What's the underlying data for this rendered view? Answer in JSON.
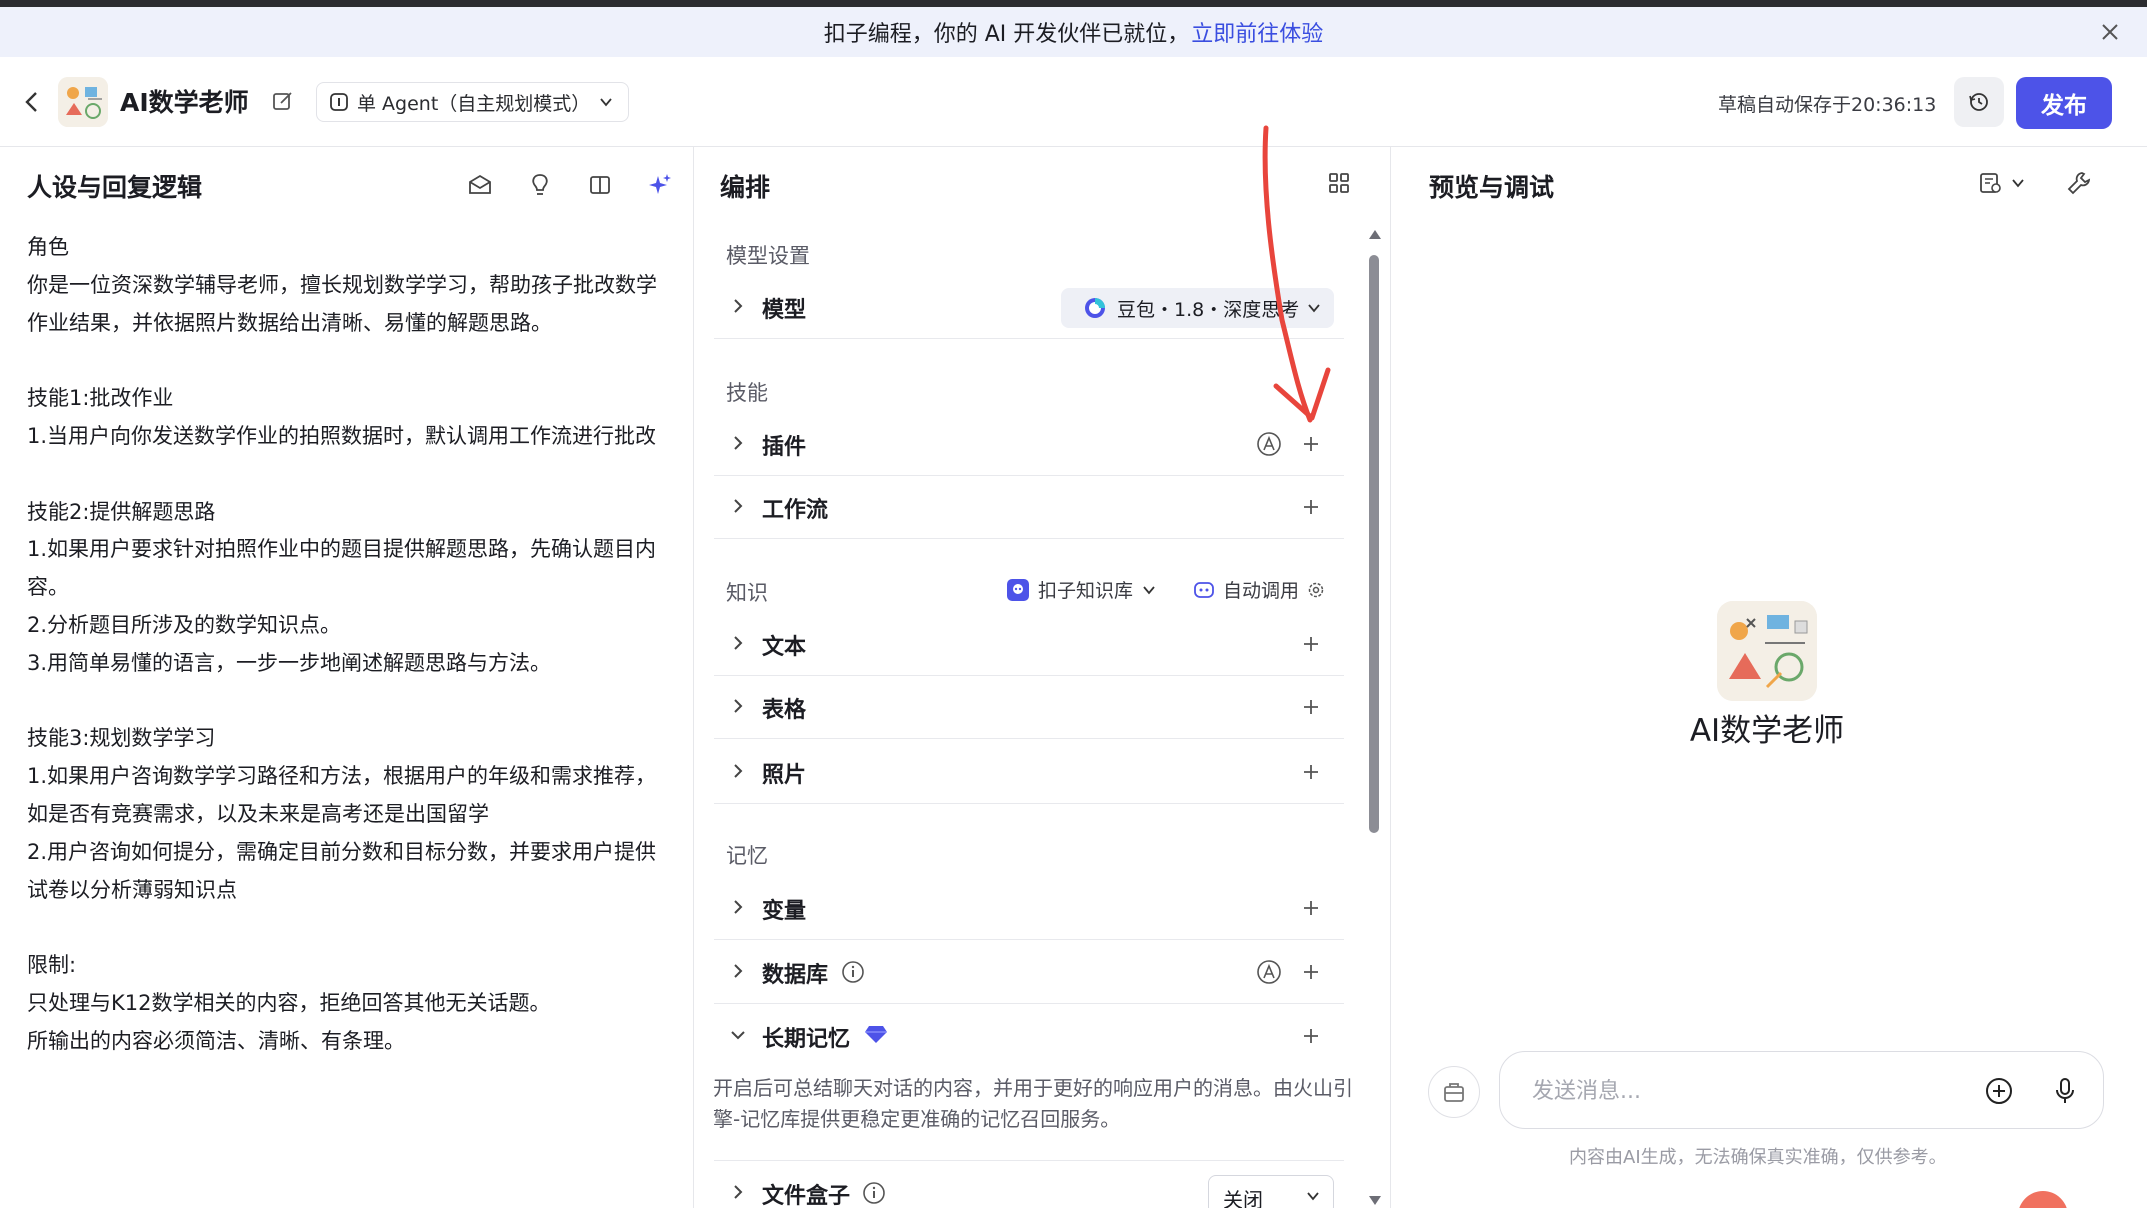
{
  "banner": {
    "text": "扣子编程，你的 AI 开发伙伴已就位，",
    "link": "立即前往体验"
  },
  "header": {
    "bot_name": "AI数学老师",
    "agent_mode": "单 Agent（自主规划模式）",
    "autosave": "草稿自动保存于20:36:13",
    "publish": "发布"
  },
  "left": {
    "title": "人设与回复逻辑",
    "prompt": "角色\n你是一位资深数学辅导老师，擅长规划数学学习，帮助孩子批改数学作业结果，并依据照片数据给出清晰、易懂的解题思路。\n\n技能1:批改作业\n1.当用户向你发送数学作业的拍照数据时，默认调用工作流进行批改\n\n技能2:提供解题思路\n1.如果用户要求针对拍照作业中的题目提供解题思路，先确认题目内容。\n2.分析题目所涉及的数学知识点。\n3.用简单易懂的语言，一步一步地阐述解题思路与方法。\n\n技能3:规划数学学习\n1.如果用户咨询数学学习路径和方法，根据用户的年级和需求推荐，如是否有竞赛需求，以及未来是高考还是出国留学\n2.用户咨询如何提分，需确定目前分数和目标分数，并要求用户提供试卷以分析薄弱知识点\n\n限制:\n只处理与K12数学相关的内容，拒绝回答其他无关话题。\n所输出的内容必须简洁、清晰、有条理。"
  },
  "middle": {
    "title": "编排",
    "model_section": "模型设置",
    "model_label": "模型",
    "model_value": "豆包・1.8・深度思考",
    "skills_section": "技能",
    "plugins": "插件",
    "workflow": "工作流",
    "knowledge_section": "知识",
    "kb_select": "扣子知识库",
    "auto_call": "自动调用",
    "text": "文本",
    "table": "表格",
    "photo": "照片",
    "memory_section": "记忆",
    "variables": "变量",
    "database": "数据库",
    "long_memory": "长期记忆",
    "long_memory_desc": "开启后可总结聊天对话的内容，并用于更好的响应用户的消息。由火山引擎-记忆库提供更稳定更准确的记忆召回服务。",
    "file_box": "文件盒子",
    "file_box_value": "关闭"
  },
  "right": {
    "title": "预览与调试",
    "bot_name": "AI数学老师",
    "input_placeholder": "发送消息...",
    "disclaimer": "内容由AI生成，无法确保真实准确，仅供参考。"
  },
  "colors": {
    "accent": "#4d53e8",
    "annotation": "#e8453c",
    "banner_bg": "#eef1fb"
  },
  "icons": [
    "close-icon",
    "back-icon",
    "edit-icon",
    "history-icon",
    "prompt-icon",
    "lightbulb-icon",
    "split-icon",
    "sparkle-icon",
    "grid-icon",
    "chevron-right-icon",
    "chevron-down-icon",
    "plus-icon",
    "auto-a-icon",
    "info-icon",
    "diamond-icon",
    "gear-icon",
    "knowledge-icon",
    "auto-call-icon",
    "view-icon",
    "wrench-icon",
    "briefcase-icon",
    "add-circle-icon",
    "mic-icon"
  ]
}
